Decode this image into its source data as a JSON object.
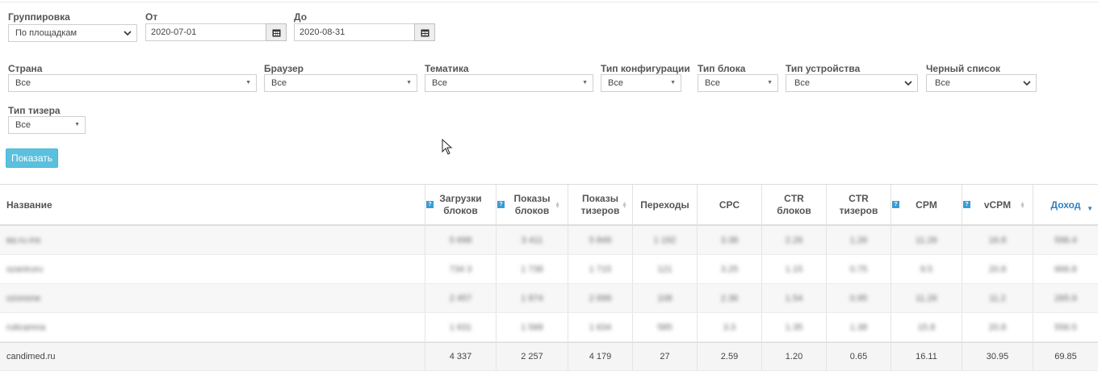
{
  "filters": {
    "grouping": {
      "label": "Группировка",
      "value": "По площадкам"
    },
    "date_from": {
      "label": "От",
      "value": "2020-07-01"
    },
    "date_to": {
      "label": "До",
      "value": "2020-08-31"
    },
    "country": {
      "label": "Страна",
      "value": "Все"
    },
    "browser": {
      "label": "Браузер",
      "value": "Все"
    },
    "topic": {
      "label": "Тематика",
      "value": "Все"
    },
    "config_type": {
      "label": "Тип конфигурации",
      "value": "Все"
    },
    "block_type": {
      "label": "Тип блока",
      "value": "Все"
    },
    "device_type": {
      "label": "Тип устройства",
      "value": "Все"
    },
    "blacklist": {
      "label": "Черный список",
      "value": "Все"
    },
    "teaser_type": {
      "label": "Тип тизера",
      "value": "Все"
    },
    "show_button": "Показать"
  },
  "table": {
    "columns": [
      {
        "l1": "Название",
        "l2": ""
      },
      {
        "l1": "Загрузки",
        "l2": "блоков"
      },
      {
        "l1": "Показы",
        "l2": "блоков"
      },
      {
        "l1": "Показы",
        "l2": "тизеров"
      },
      {
        "l1": "Переходы",
        "l2": ""
      },
      {
        "l1": "CPC",
        "l2": ""
      },
      {
        "l1": "CTR",
        "l2": "блоков"
      },
      {
        "l1": "CTR",
        "l2": "тизеров"
      },
      {
        "l1": "CPM",
        "l2": ""
      },
      {
        "l1": "vCPM",
        "l2": ""
      },
      {
        "l1": "Доход",
        "l2": ""
      }
    ],
    "blurred_rows": [
      [
        "ва.ru.ms",
        "5 698",
        "3 411",
        "5 849",
        "1 192",
        "3.38",
        "2.26",
        "1.26",
        "11.26",
        "16.8",
        "596.4"
      ],
      [
        "szaniruru",
        "734 3",
        "1 738",
        "1 715",
        "121",
        "3.25",
        "1.15",
        "0.75",
        "9.5",
        "20.8",
        "666.8"
      ],
      [
        "ozonone",
        "2 457",
        "1 874",
        "2 699",
        "108",
        "2.36",
        "1.54",
        "0.95",
        "11.26",
        "11.2",
        "265.9"
      ],
      [
        "ruticamna",
        "1 631",
        "1 568",
        "1 634",
        "585",
        "3.3",
        "1.35",
        "1.38",
        "15.8",
        "20.8",
        "556.5"
      ]
    ],
    "last_row": [
      "candimed.ru",
      "4 337",
      "2 257",
      "4 179",
      "27",
      "2.59",
      "1.20",
      "0.65",
      "16.11",
      "30.95",
      "69.85"
    ]
  }
}
